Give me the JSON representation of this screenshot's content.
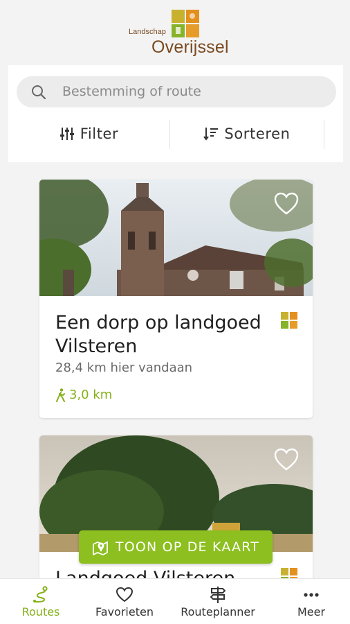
{
  "logo": {
    "small": "Landschap",
    "big": "Overijssel"
  },
  "search": {
    "placeholder": "Bestemming of route"
  },
  "toolbar": {
    "filter_label": "Filter",
    "sort_label": "Sorteren"
  },
  "cards": [
    {
      "title": "Een dorp op landgoed Vilsteren",
      "distance": "28,4 km hier vandaan",
      "length": "3,0 km"
    },
    {
      "title": "Landgoed Vilsteren"
    }
  ],
  "map_button": {
    "label": "TOON OP DE KAART"
  },
  "nav": {
    "items": [
      {
        "label": "Routes",
        "icon": "route-icon",
        "active": true
      },
      {
        "label": "Favorieten",
        "icon": "heart-icon"
      },
      {
        "label": "Routeplanner",
        "icon": "signpost-icon"
      },
      {
        "label": "Meer",
        "icon": "more-icon"
      }
    ]
  },
  "colors": {
    "accent": "#8cbf1f",
    "accent_text": "#85b11b",
    "brand_brown": "#7a4a22"
  }
}
